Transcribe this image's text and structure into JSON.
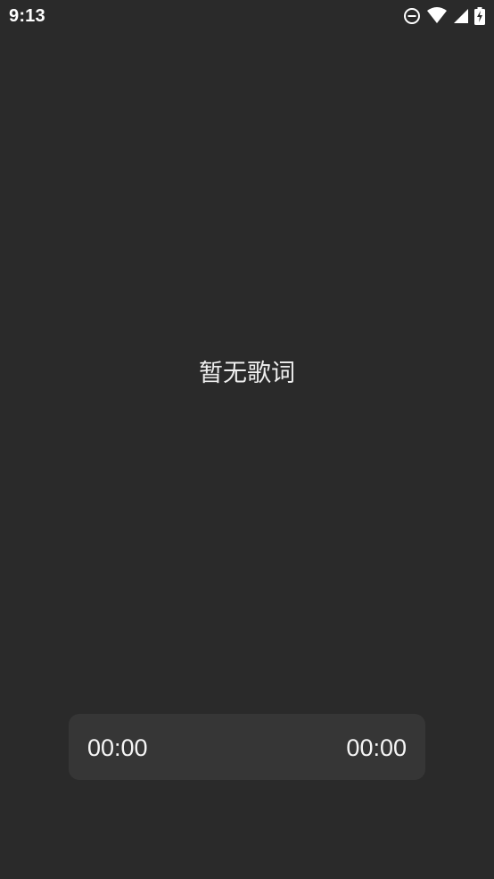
{
  "status_bar": {
    "time": "9:13",
    "icons": [
      "do-not-disturb-icon",
      "wifi-icon",
      "cellular-signal-icon",
      "battery-charging-icon"
    ]
  },
  "lyrics": {
    "empty_text": "暂无歌词"
  },
  "player": {
    "current_time": "00:00",
    "total_time": "00:00"
  },
  "colors": {
    "background": "#2a2a2a",
    "panel": "#363636",
    "text": "#f2f2f2"
  }
}
